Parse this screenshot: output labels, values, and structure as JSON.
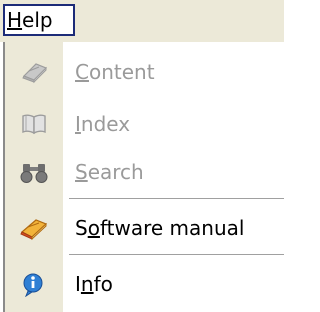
{
  "menu": {
    "title_mnemonic": "H",
    "title_rest": "elp"
  },
  "items": [
    {
      "pre": "",
      "mnemonic": "C",
      "post": "ontent",
      "icon": "content-book-icon",
      "enabled": false
    },
    {
      "pre": "",
      "mnemonic": "I",
      "post": "ndex",
      "icon": "index-book-icon",
      "enabled": false
    },
    {
      "pre": "",
      "mnemonic": "S",
      "post": "earch",
      "icon": "binoculars-icon",
      "enabled": false
    },
    {
      "pre": "S",
      "mnemonic": "o",
      "post": "ftware manual",
      "icon": "manual-icon",
      "enabled": true
    },
    {
      "pre": "I",
      "mnemonic": "n",
      "post": "fo",
      "icon": "info-icon",
      "enabled": true
    }
  ]
}
